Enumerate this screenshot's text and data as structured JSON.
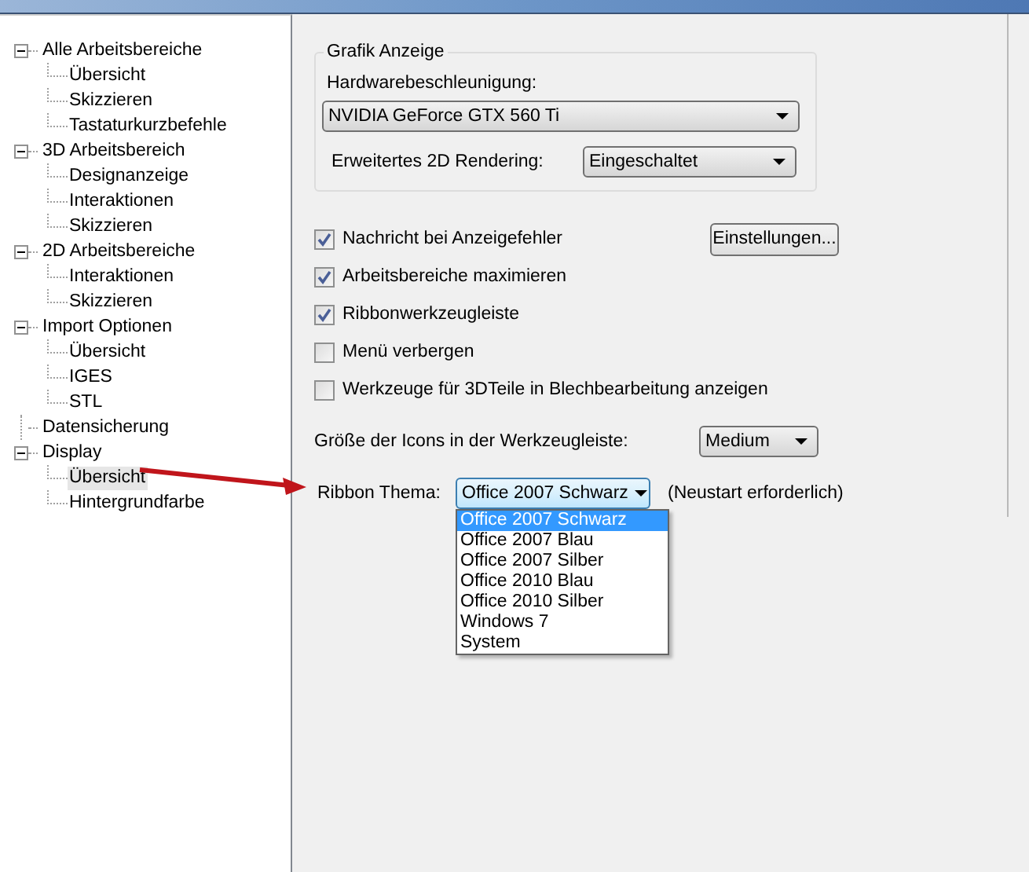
{
  "tree": [
    {
      "label": "Alle Arbeitsbereiche",
      "expanded": true,
      "selected": false,
      "children": [
        {
          "label": "Übersicht",
          "selected": false
        },
        {
          "label": "Skizzieren",
          "selected": false
        },
        {
          "label": "Tastaturkurzbefehle",
          "selected": false
        }
      ]
    },
    {
      "label": "3D Arbeitsbereich",
      "expanded": true,
      "selected": false,
      "children": [
        {
          "label": "Designanzeige",
          "selected": false
        },
        {
          "label": "Interaktionen",
          "selected": false
        },
        {
          "label": "Skizzieren",
          "selected": false
        }
      ]
    },
    {
      "label": "2D Arbeitsbereiche",
      "expanded": true,
      "selected": false,
      "children": [
        {
          "label": "Interaktionen",
          "selected": false
        },
        {
          "label": "Skizzieren",
          "selected": false
        }
      ]
    },
    {
      "label": "Import Optionen",
      "expanded": true,
      "selected": false,
      "children": [
        {
          "label": "Übersicht",
          "selected": false
        },
        {
          "label": "IGES",
          "selected": false
        },
        {
          "label": "STL",
          "selected": false
        }
      ]
    },
    {
      "label": "Datensicherung",
      "selected": false
    },
    {
      "label": "Display",
      "expanded": true,
      "selected": false,
      "children": [
        {
          "label": "Übersicht",
          "selected": true
        },
        {
          "label": "Hintergrundfarbe",
          "selected": false
        }
      ]
    }
  ],
  "graphics_group": {
    "title": "Grafik Anzeige",
    "hardware_label": "Hardwarebeschleunigung:",
    "hardware_value": "NVIDIA GeForce GTX 560 Ti",
    "rendering_label": "Erweitertes 2D Rendering:",
    "rendering_value": "Eingeschaltet"
  },
  "checkboxes": [
    {
      "label": "Nachricht bei Anzeigefehler",
      "checked": true
    },
    {
      "label": "Arbeitsbereiche maximieren",
      "checked": true
    },
    {
      "label": "Ribbonwerkzeugleiste",
      "checked": true
    },
    {
      "label": "Menü verbergen",
      "checked": false
    },
    {
      "label": "Werkzeuge für 3DTeile in Blechbearbeitung anzeigen",
      "checked": false
    }
  ],
  "settings_button": "Einstellungen...",
  "icon_size": {
    "label": "Größe der Icons in der Werkzeugleiste:",
    "value": "Medium"
  },
  "ribbon_theme": {
    "label": "Ribbon Thema:",
    "value": "Office 2007 Schwarz",
    "note": "(Neustart erforderlich)",
    "expanded": true,
    "options": [
      {
        "label": "Office 2007 Schwarz",
        "selected": true
      },
      {
        "label": "Office 2007 Blau",
        "selected": false
      },
      {
        "label": "Office 2007 Silber",
        "selected": false
      },
      {
        "label": "Office 2010 Blau",
        "selected": false
      },
      {
        "label": "Office 2010 Silber",
        "selected": false
      },
      {
        "label": "Windows 7",
        "selected": false
      },
      {
        "label": "System",
        "selected": false
      }
    ]
  }
}
